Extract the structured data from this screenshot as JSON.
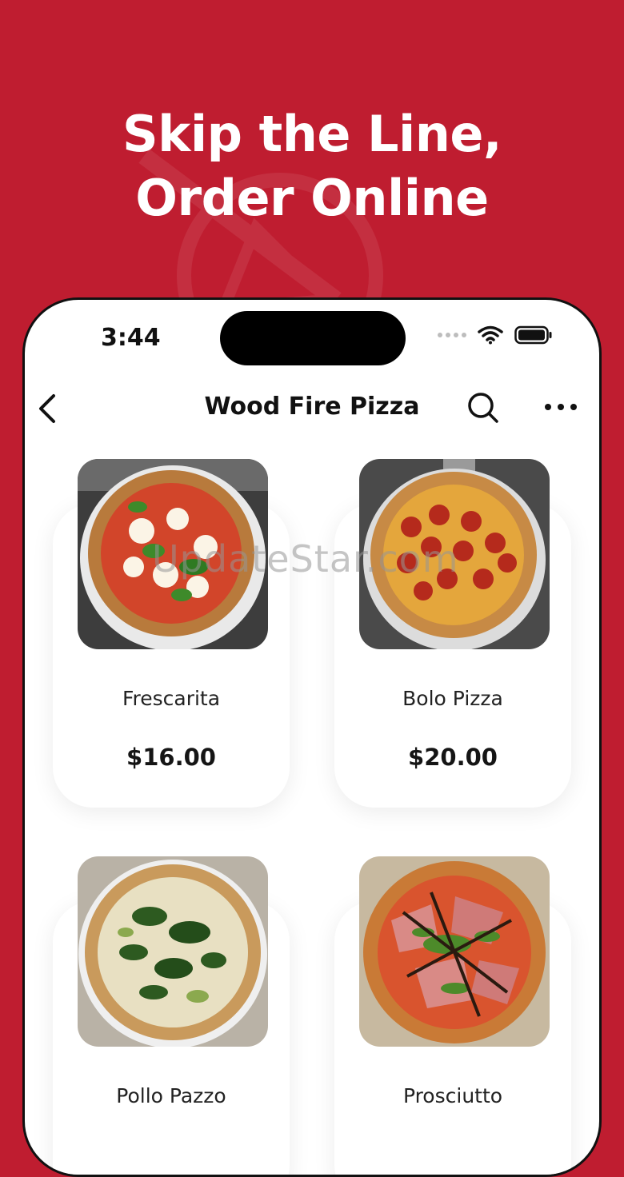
{
  "promo": {
    "line1": "Skip the Line,",
    "line2": "Order Online",
    "background_color": "#bf1d30"
  },
  "status_bar": {
    "time": "3:44",
    "icons": [
      "cellular-icon",
      "wifi-icon",
      "battery-icon"
    ]
  },
  "navbar": {
    "title": "Wood Fire Pizza",
    "back_icon": "chevron-left-icon",
    "search_icon": "search-icon",
    "more_icon": "more-horizontal-icon"
  },
  "products": [
    {
      "name": "Frescarita",
      "price": "$16.00",
      "image": "margherita-pizza"
    },
    {
      "name": "Bolo Pizza",
      "price": "$20.00",
      "image": "pepperoni-pizza"
    },
    {
      "name": "Pollo Pazzo",
      "image": "spinach-white-pizza"
    },
    {
      "name": "Prosciutto",
      "image": "prosciutto-arugula-pizza"
    }
  ],
  "watermark": "UpdateStar.com"
}
